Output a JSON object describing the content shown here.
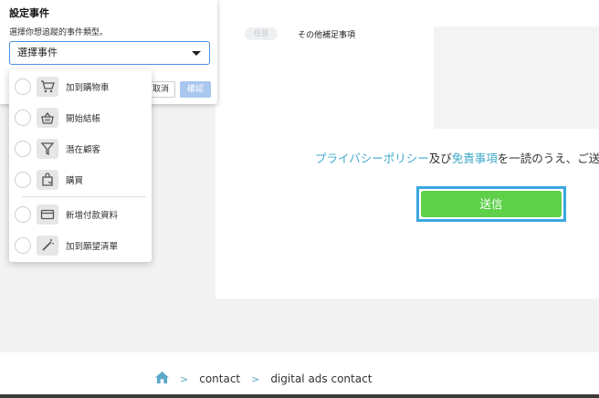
{
  "panel": {
    "title": "設定事件",
    "subtitle": "選擇你想追蹤的事件類型。",
    "select_value": "選擇事件",
    "cancel_label": "取消",
    "confirm_label": "確認"
  },
  "dropdown": {
    "items": [
      {
        "label": "加到購物車",
        "icon": "cart-icon"
      },
      {
        "label": "開始結帳",
        "icon": "basket-icon"
      },
      {
        "label": "潛在顧客",
        "icon": "filter-icon"
      },
      {
        "label": "購買",
        "icon": "shopping-bag-icon"
      },
      {
        "label": "新增付款資料",
        "icon": "credit-card-icon"
      },
      {
        "label": "加到願望清單",
        "icon": "magic-wand-icon"
      }
    ]
  },
  "form": {
    "tag_label": "任意",
    "other_label": "その他補足事項",
    "consent_privacy": "プライバシーポリシー",
    "consent_and": "及び",
    "consent_disclaimer": "免責事項",
    "consent_rest": "を一読のうえ、ご送",
    "submit_label": "送信"
  },
  "breadcrumb": {
    "items": [
      "contact",
      "digital ads contact"
    ],
    "separator": ">"
  },
  "colors": {
    "link": "#3fa9c9",
    "submit": "#5ed04a",
    "submit_border": "#3aa6df",
    "select_border": "#4a90e2",
    "confirm": "#a9c7ee"
  }
}
